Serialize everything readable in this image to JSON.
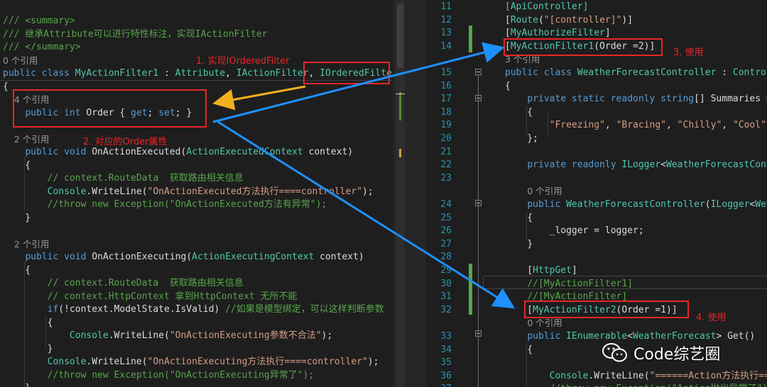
{
  "left_code": [
    {
      "text": "/// <summary>",
      "cls": "cm"
    },
    {
      "text": "/// 继承Attribute可以进行特性标注，实现IActionFilter",
      "cls": "cm"
    },
    {
      "text": "/// </summary>",
      "cls": "cm"
    },
    {
      "text": "0 个引用",
      "cls": "codelens"
    },
    {
      "html": "<span class='kw'>public class</span> <span class='ty'>MyActionFilter1</span> : <span class='ty'>Attribute</span>, <span class='ty'>IActionFilter</span>, <span class='ty'>IOrderedFilter</span>"
    },
    {
      "text": "{"
    },
    {
      "text": "    4 个引用",
      "cls": "codelens"
    },
    {
      "html": "    <span class='kw'>public int</span> Order { <span class='kw'>get</span>; <span class='kw'>set</span>; }"
    },
    {
      "text": ""
    },
    {
      "text": "    2 个引用",
      "cls": "codelens"
    },
    {
      "html": "    <span class='kw'>public void</span> OnActionExecuted(<span class='ty'>ActionExecutedContext</span> context)"
    },
    {
      "text": "    {"
    },
    {
      "html": "        <span class='cm'>// context.RouteData  获取路由相关信息</span>"
    },
    {
      "html": "        <span class='ty'>Console</span>.WriteLine(<span class='str'>\"OnActionExecuted方法执行====controller\"</span>);"
    },
    {
      "html": "        <span class='cm'>//throw new Exception(\"OnActionExecuted方法有异常\");</span>"
    },
    {
      "text": "    }"
    },
    {
      "text": ""
    },
    {
      "text": "    2 个引用",
      "cls": "codelens"
    },
    {
      "html": "    <span class='kw'>public void</span> OnActionExecuting(<span class='ty'>ActionExecutingContext</span> context)"
    },
    {
      "text": "    {"
    },
    {
      "html": "        <span class='cm'>// context.RouteData  获取路由相关信息</span>"
    },
    {
      "html": "        <span class='cm'>// context.HttpContext 拿到HttpContext 无所不能</span>"
    },
    {
      "html": "        <span class='kw'>if</span>(!context.ModelState.IsValid) <span class='cm'>//如果是模型绑定，可以这样判断参数</span>"
    },
    {
      "text": "        {"
    },
    {
      "html": "            <span class='ty'>Console</span>.WriteLine(<span class='str'>\"OnActionExecuting参数不合法\"</span>);"
    },
    {
      "text": "        }"
    },
    {
      "html": "        <span class='ty'>Console</span>.WriteLine(<span class='str'>\"OnActionExecuting方法执行====controller\"</span>);"
    },
    {
      "html": "        <span class='cm'>//throw new Exception(\"OnActionExecuting异常了\");</span>"
    },
    {
      "text": "    }"
    }
  ],
  "right_code": [
    {
      "n": "11",
      "html": "<span class='at'>[ApiController]</span>"
    },
    {
      "n": "12",
      "html": "[<span class='at'>Route</span>(<span class='str'>\"[controller]\"</span>)]"
    },
    {
      "n": "13",
      "html": "[<span class='at'>MyAuthorizeFilter</span>]"
    },
    {
      "n": "14",
      "html": "[<span class='at'>MyActionFilter1</span>(Order =2)]"
    },
    {
      "n": "",
      "html": "<span class='codelens'>3 个引用</span>"
    },
    {
      "n": "15",
      "html": "<span class='kw'>public class</span> <span class='ty'>WeatherForecastController</span> : <span class='ty'>ControllerBase</span>"
    },
    {
      "n": "16",
      "html": "{"
    },
    {
      "n": "17",
      "html": "    <span class='kw'>private static readonly string</span>[] Summaries = <span class='kw'>new</span>[]"
    },
    {
      "n": "18",
      "html": "    {"
    },
    {
      "n": "19",
      "html": "        <span class='str'>\"Freezing\"</span>, <span class='str'>\"Bracing\"</span>, <span class='str'>\"Chilly\"</span>, <span class='str'>\"Cool\"</span>, <span class='str'>\"Mild\"</span>"
    },
    {
      "n": "20",
      "html": "    };"
    },
    {
      "n": "21",
      "html": ""
    },
    {
      "n": "22",
      "html": "    <span class='kw'>private readonly</span> <span class='ty'>ILogger</span>&lt;<span class='ty'>WeatherForecastController</span>&gt;"
    },
    {
      "n": "23",
      "html": ""
    },
    {
      "n": "",
      "html": "    <span class='codelens'>0 个引用</span>"
    },
    {
      "n": "24",
      "html": "    <span class='kw'>public</span> <span class='ty'>WeatherForecastController</span>(<span class='ty'>ILogger</span>&lt;<span class='ty'>WeatherForecastController</span>&gt;"
    },
    {
      "n": "25",
      "html": "    {"
    },
    {
      "n": "26",
      "html": "        _logger = logger;"
    },
    {
      "n": "27",
      "html": "    }"
    },
    {
      "n": "28",
      "html": ""
    },
    {
      "n": "29",
      "html": "    [<span class='at'>HttpGet</span>]"
    },
    {
      "n": "30",
      "html": "    <span class='cm'>//[MyActionFilter1]</span>"
    },
    {
      "n": "31",
      "html": "    <span class='cm'>//[MyActionFilter]</span>"
    },
    {
      "n": "32",
      "html": "    [<span class='at'>MyActionFilter2</span>(Order =1)]"
    },
    {
      "n": "",
      "html": "    <span class='codelens'>0 个引用</span>"
    },
    {
      "n": "33",
      "html": "    <span class='kw'>public</span> <span class='ty'>IEnumerable</span>&lt;<span class='ty'>WeatherForecast</span>&gt; Get()"
    },
    {
      "n": "34",
      "html": "    {"
    },
    {
      "n": "35",
      "html": ""
    },
    {
      "n": "36",
      "html": "        <span class='ty'>Console</span>.WriteLine(<span class='str'>\"======Action方法执行====\"</span>);"
    },
    {
      "n": "37",
      "html": "        <span class='cm'>//throw new Exception(\"Action抛出异常了\");</span>"
    }
  ],
  "annotations": {
    "a1": "1. 实现IOrderedFilter",
    "a2": "2. 对应的Order属性",
    "a3": "3. 使用",
    "a4": "4. 使用"
  },
  "watermark": {
    "text": "Code综艺圈",
    "icon": "wechat-icon"
  },
  "colors": {
    "annotation": "#e8262a",
    "arrow_blue": "#1e90ff",
    "arrow_yellow": "#f2b01e"
  }
}
